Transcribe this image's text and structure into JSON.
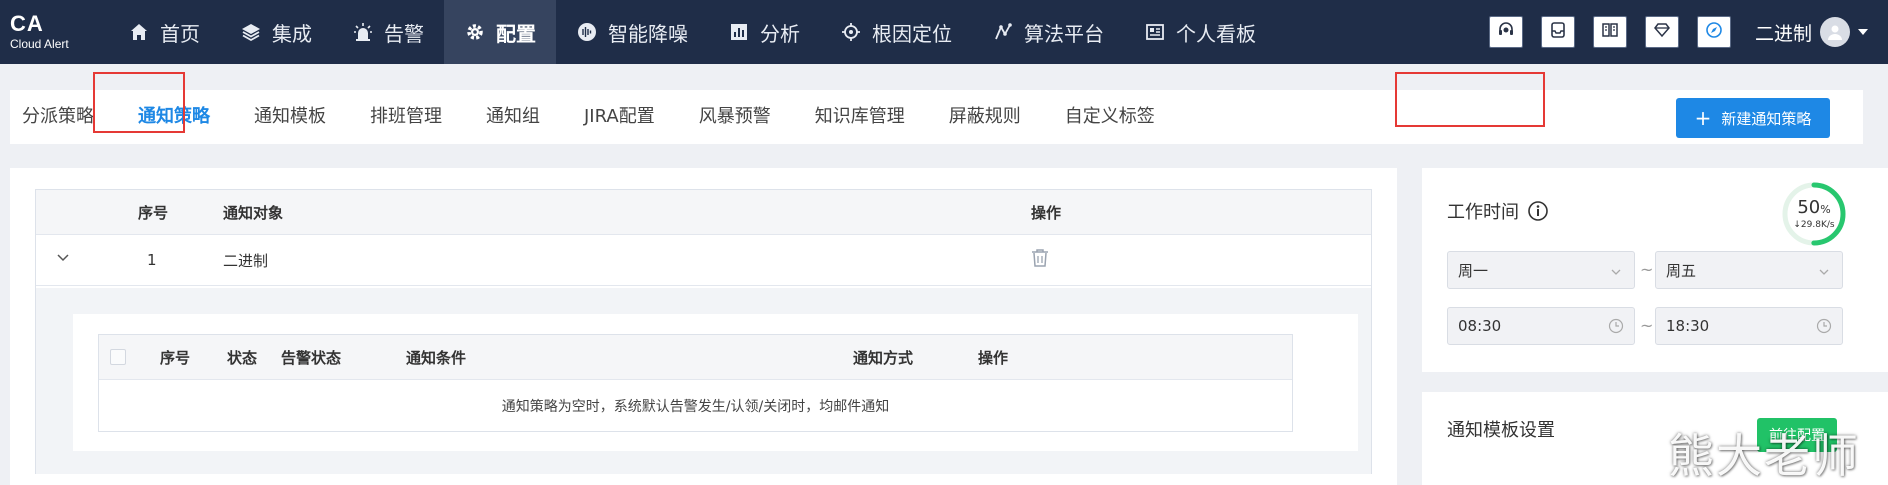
{
  "logo": {
    "title": "CA",
    "subtitle": "Cloud Alert"
  },
  "nav": {
    "items": [
      {
        "label": "首页",
        "icon": "home-icon"
      },
      {
        "label": "集成",
        "icon": "layers-icon"
      },
      {
        "label": "告警",
        "icon": "alarm-light-icon"
      },
      {
        "label": "配置",
        "icon": "gear-icon",
        "active": true
      },
      {
        "label": "智能降噪",
        "icon": "waveform-icon"
      },
      {
        "label": "分析",
        "icon": "bar-chart-icon"
      },
      {
        "label": "根因定位",
        "icon": "locate-icon"
      },
      {
        "label": "算法平台",
        "icon": "algorithm-icon"
      },
      {
        "label": "个人看板",
        "icon": "dashboard-card-icon"
      }
    ],
    "tools": [
      "headset-icon",
      "inbox-icon",
      "book-icon",
      "diamond-icon",
      "compass-icon"
    ],
    "user": "二进制"
  },
  "tabs": {
    "items": [
      "分派策略",
      "通知策略",
      "通知模板",
      "排班管理",
      "通知组",
      "JIRA配置",
      "风暴预警",
      "知识库管理",
      "屏蔽规则",
      "自定义标签"
    ],
    "active_index": 1,
    "new_button": "新建通知策略"
  },
  "table": {
    "headers": {
      "index": "序号",
      "target": "通知对象",
      "action": "操作"
    },
    "row": {
      "index": "1",
      "target": "二进制"
    },
    "inner": {
      "headers": {
        "index": "序号",
        "status": "状态",
        "alert_status": "告警状态",
        "condition": "通知条件",
        "method": "通知方式",
        "action": "操作"
      },
      "empty": "通知策略为空时，系统默认告警发生/认领/关闭时，均邮件通知"
    }
  },
  "worktime": {
    "title": "工作时间",
    "day_from": "周一",
    "day_to": "周五",
    "time_from": "08:30",
    "time_to": "18:30",
    "tilde": "~"
  },
  "speed": {
    "percent": "50",
    "percent_unit": "%",
    "rate": "↓29.8K/s",
    "fraction": 0.5
  },
  "template": {
    "title": "通知模板设置",
    "button": "前往配置"
  },
  "watermark": "熊大老师",
  "colors": {
    "nav_bg": "#1f2d48",
    "accent": "#1e88e5",
    "highlight": "#e53935",
    "green": "#21c267"
  }
}
